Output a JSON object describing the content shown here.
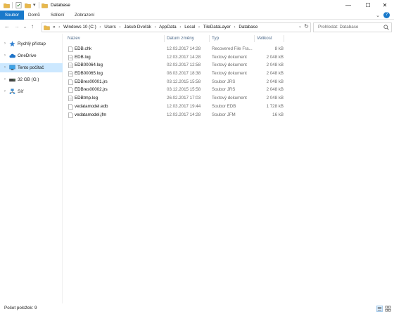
{
  "window": {
    "title": "Database",
    "controls": {
      "minimize": "—",
      "maximize": "☐",
      "close": "✕"
    }
  },
  "ribbon": {
    "tabs": [
      "Soubor",
      "Domů",
      "Sdílení",
      "Zobrazení"
    ],
    "expand_chevron": "⌄",
    "help": "?"
  },
  "nav": {
    "back": "←",
    "forward": "→",
    "recent": "⌄",
    "up": "↑",
    "breadcrumb_overflow": "«",
    "breadcrumbs": [
      "Windows 10 (C:)",
      "Users",
      "Jakub Dvořák",
      "AppData",
      "Local",
      "TileDataLayer",
      "Database"
    ],
    "separator": "›",
    "dropdown": "⌄",
    "refresh": "↻",
    "search_placeholder": "Prohledat: Database"
  },
  "sidebar": {
    "items": [
      {
        "label": "Rychlý přístup",
        "icon": "star-icon",
        "selected": false
      },
      {
        "label": "OneDrive",
        "icon": "cloud-icon",
        "selected": false
      },
      {
        "label": "Tento počítač",
        "icon": "computer-icon",
        "selected": true
      },
      {
        "label": "32 GB (G:)",
        "icon": "drive-icon",
        "selected": false
      },
      {
        "label": "Síť",
        "icon": "network-icon",
        "selected": false
      }
    ]
  },
  "columns": {
    "name": "Název",
    "date": "Datum změny",
    "type": "Typ",
    "size": "Velikost"
  },
  "files": [
    {
      "name": "EDB.chk",
      "date": "12.03.2017 14:28",
      "type": "Recovered File Fra...",
      "size": "8 kB"
    },
    {
      "name": "EDB.log",
      "date": "12.03.2017 14:28",
      "type": "Textový dokument",
      "size": "2 048 kB"
    },
    {
      "name": "EDB00064.log",
      "date": "02.03.2017 12:58",
      "type": "Textový dokument",
      "size": "2 048 kB"
    },
    {
      "name": "EDB00065.log",
      "date": "08.03.2017 18:38",
      "type": "Textový dokument",
      "size": "2 048 kB"
    },
    {
      "name": "EDBres00001.jrs",
      "date": "03.12.2015 15:58",
      "type": "Soubor JRS",
      "size": "2 048 kB"
    },
    {
      "name": "EDBres00002.jrs",
      "date": "03.12.2015 15:58",
      "type": "Soubor JRS",
      "size": "2 048 kB"
    },
    {
      "name": "EDBtmp.log",
      "date": "26.02.2017 17:03",
      "type": "Textový dokument",
      "size": "2 048 kB"
    },
    {
      "name": "vedatamodel.edb",
      "date": "12.03.2017 19:44",
      "type": "Soubor EDB",
      "size": "1 728 kB"
    },
    {
      "name": "vedatamodel.jfm",
      "date": "12.03.2017 14:28",
      "type": "Soubor JFM",
      "size": "16 kB"
    }
  ],
  "status": {
    "item_count": "Počet položek: 9"
  },
  "colors": {
    "accent": "#1979ca",
    "selected_bg": "#cce8ff",
    "folder": "#e8b84a"
  }
}
